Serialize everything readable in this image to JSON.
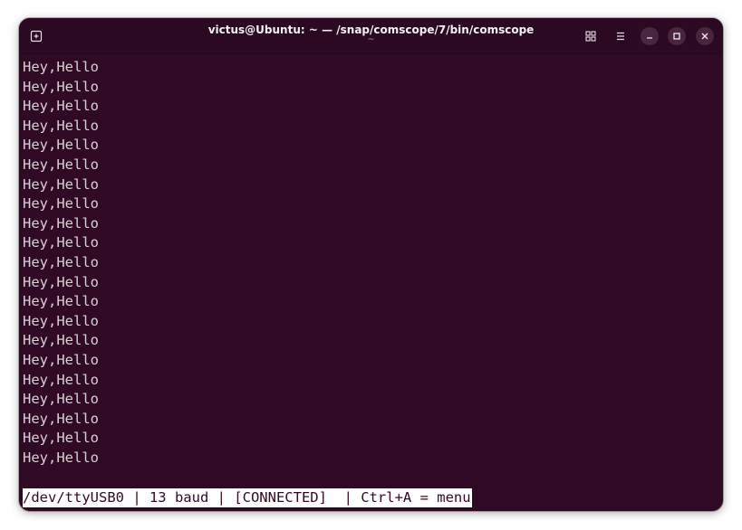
{
  "window": {
    "title": "victus@Ubuntu: ~ — /snap/comscope/7/bin/comscope",
    "subtitle": "~"
  },
  "icons": {
    "new_tab": "new-tab-icon",
    "grid": "grid-icon",
    "menu": "hamburger-menu-icon",
    "minimize": "minimize-icon",
    "maximize": "maximize-icon",
    "close": "close-icon"
  },
  "terminal": {
    "lines": [
      "Hey,Hello",
      "Hey,Hello",
      "Hey,Hello",
      "Hey,Hello",
      "Hey,Hello",
      "Hey,Hello",
      "Hey,Hello",
      "Hey,Hello",
      "Hey,Hello",
      "Hey,Hello",
      "Hey,Hello",
      "Hey,Hello",
      "Hey,Hello",
      "Hey,Hello",
      "Hey,Hello",
      "Hey,Hello",
      "Hey,Hello",
      "Hey,Hello",
      "Hey,Hello",
      "Hey,Hello",
      "Hey,Hello"
    ],
    "status_bar": "/dev/ttyUSB0 | 13 baud | [CONNECTED]  | Ctrl+A = menu"
  },
  "colors": {
    "background": "#300a24",
    "titlebar": "#2c0922",
    "text": "#d8d0d5",
    "status_bg": "#ffffff"
  }
}
